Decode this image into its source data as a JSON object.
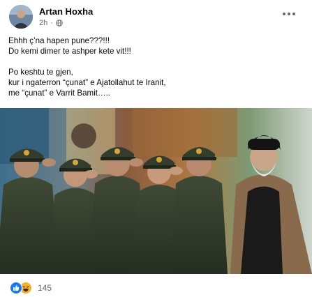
{
  "post": {
    "author": "Artan Hoxha",
    "time": "2h",
    "privacy_icon": "globe-icon",
    "menu_icon": "more-horizontal-icon",
    "paragraphs": [
      {
        "lines": [
          "Ehhh ç’na hapen pune???!!!",
          "Do kemi dimer te ashper kete vit!!!"
        ]
      },
      {
        "lines": [
          "Po keshtu te gjen,",
          "kur i ngaterron “çunat” e Ajatollahut te Iranit,",
          "me “çunat” e Varrit Bamit….."
        ]
      }
    ],
    "reactions": {
      "icons": [
        "like-icon",
        "haha-icon"
      ],
      "count": "145"
    },
    "colors": {
      "like": "#1877f2",
      "haha": "#f7b125",
      "secondary_text": "#65676b"
    }
  }
}
